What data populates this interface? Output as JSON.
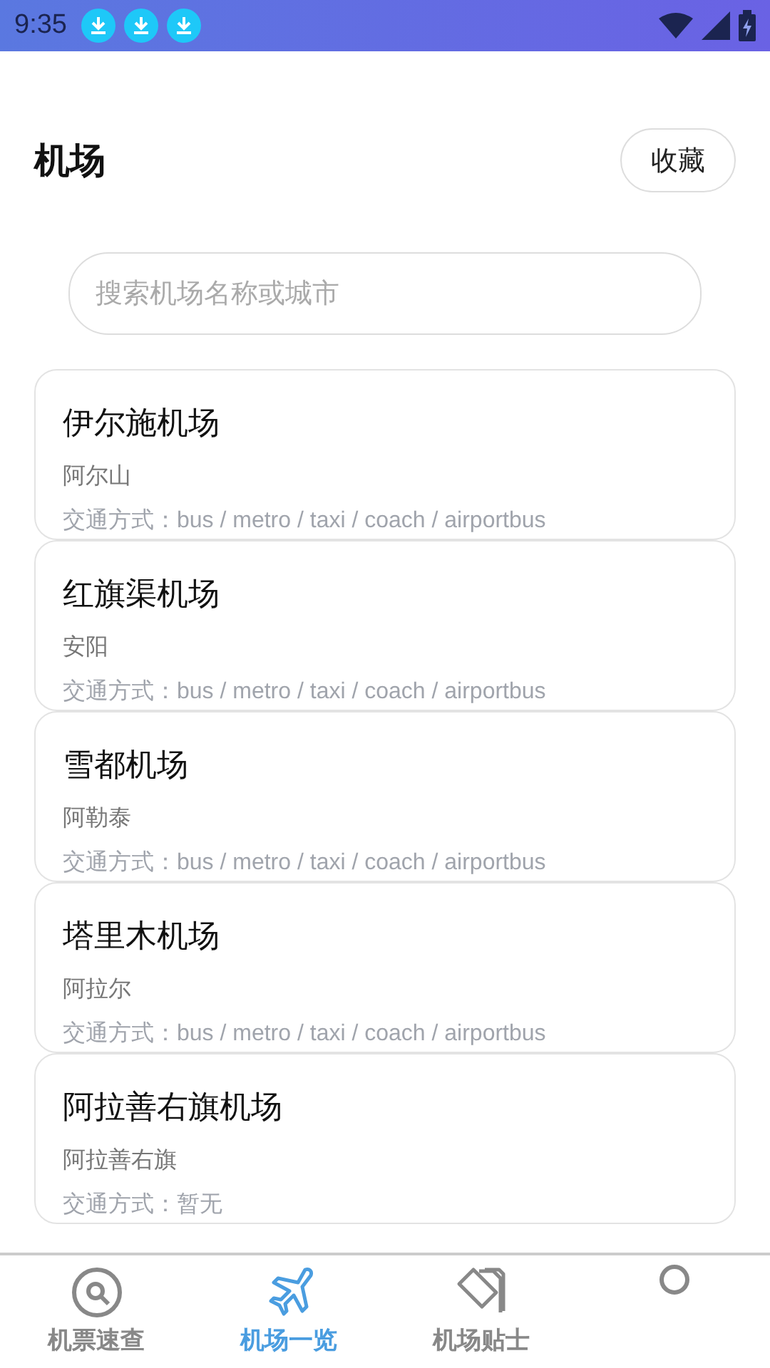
{
  "status_bar": {
    "time": "9:35",
    "notifications": [
      {
        "kind": "download"
      },
      {
        "kind": "download"
      },
      {
        "kind": "download"
      }
    ]
  },
  "header": {
    "title": "机场",
    "favorites_button": "收藏"
  },
  "search": {
    "placeholder": "搜索机场名称或城市"
  },
  "airports": [
    {
      "name": "伊尔施机场",
      "city": "阿尔山",
      "transport": "交通方式：bus / metro / taxi / coach / airportbus"
    },
    {
      "name": "红旗渠机场",
      "city": "安阳",
      "transport": "交通方式：bus / metro / taxi / coach / airportbus"
    },
    {
      "name": "雪都机场",
      "city": "阿勒泰",
      "transport": "交通方式：bus / metro / taxi / coach / airportbus"
    },
    {
      "name": "塔里木机场",
      "city": "阿拉尔",
      "transport": "交通方式：bus / metro / taxi / coach / airportbus"
    },
    {
      "name": "阿拉善右旗机场",
      "city": "阿拉善右旗",
      "transport": "交通方式：暂无"
    }
  ],
  "tabs": [
    {
      "kind": "search",
      "label": "机票速查",
      "selected": false
    },
    {
      "kind": "plane",
      "label": "机场一览",
      "selected": true
    },
    {
      "kind": "cards",
      "label": "机场贴士",
      "selected": false
    },
    {
      "kind": "profile",
      "selected": false
    }
  ]
}
